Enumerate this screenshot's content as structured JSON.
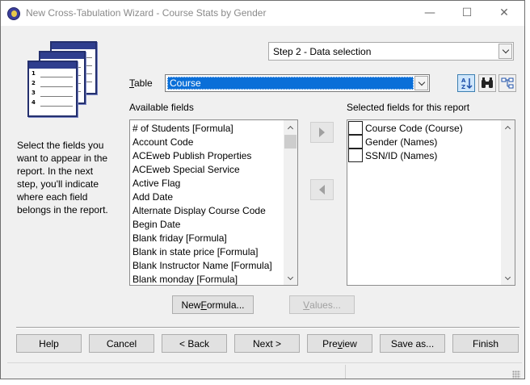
{
  "window": {
    "title": "New Cross-Tabulation Wizard - Course Stats by Gender",
    "minimize": "—",
    "maximize": "☐",
    "close": "✕"
  },
  "step": {
    "value": "Step 2 - Data selection"
  },
  "table": {
    "label_prefix": "",
    "label_hotkey": "T",
    "label_rest": "able",
    "value": "Course"
  },
  "toolbar": {
    "icons": [
      "sort-az-icon",
      "find-binoculars-icon",
      "tree-view-icon"
    ]
  },
  "available": {
    "label": "Available fields",
    "items": [
      "# of Students [Formula]",
      "Account Code",
      "ACEweb Publish Properties",
      "ACEweb Special Service",
      "Active Flag",
      "Add Date",
      "Alternate Display Course Code",
      "Begin Date",
      "Blank friday [Formula]",
      "Blank in state price [Formula]",
      "Blank Instructor Name [Formula]",
      "Blank monday [Formula]"
    ]
  },
  "selected": {
    "label": "Selected fields for this report",
    "items": [
      "Course Code (Course)",
      "Gender (Names)",
      "SSN/ID (Names)"
    ]
  },
  "help_text": "Select the fields you want to appear in the report. In the next step, you'll indicate where each field belongs in the report.",
  "buttons": {
    "new_formula_a": "New ",
    "new_formula_hk": "F",
    "new_formula_b": "ormula...",
    "values_hk": "V",
    "values_b": "alues...",
    "help": "Help",
    "cancel": "Cancel",
    "back": "< Back",
    "next": "Next >",
    "preview_a": "Pre",
    "preview_hk": "v",
    "preview_b": "iew",
    "save_as": "Save as...",
    "finish": "Finish"
  },
  "colors": {
    "selection": "#0a6fd8",
    "window_bg": "#f0f0f0"
  }
}
